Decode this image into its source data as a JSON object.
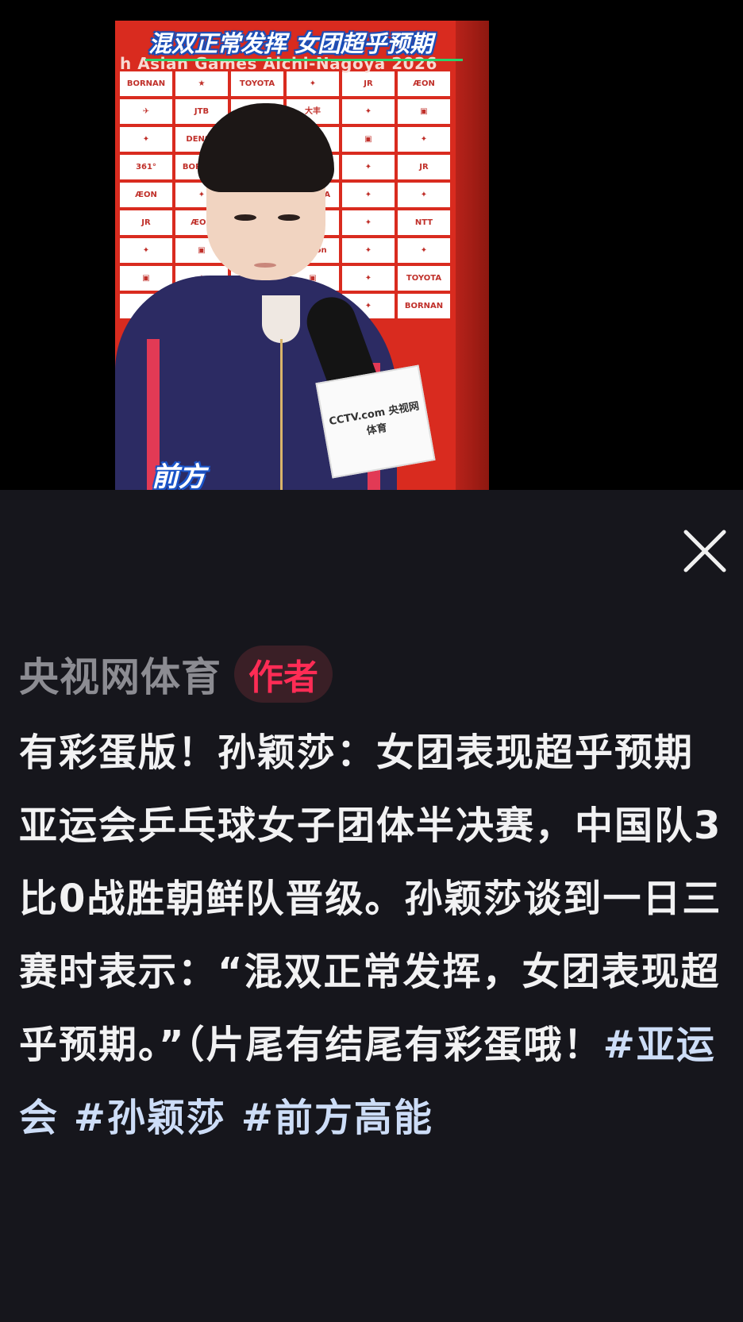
{
  "video": {
    "caption": "混双正常发挥 女团超乎预期",
    "event_text": "h Asian Games Aichi-Nagoya 2026",
    "source_logo": "前方",
    "mic_flag": "CCTV.com 央视网 体育",
    "backdrop_sponsors": [
      "BORNAN",
      "TOYOTA",
      "JR",
      "ÆON",
      "JTB",
      "361°",
      "NTT",
      "Canon",
      "DENSO",
      "大丰"
    ]
  },
  "panel": {
    "close_icon": "close-icon",
    "author": {
      "name": "央视网体育",
      "badge": "作者"
    },
    "description": {
      "title": "有彩蛋版！孙颖莎：女团表现超乎预期",
      "body": "亚运会乒乓球女子团体半决赛，中国队3比0战胜朝鲜队晋级。孙颖莎谈到一日三赛时表示：“混双正常发挥，女团表现超乎预期。”（片尾有结尾有彩蛋哦！",
      "hashtags": [
        "#亚运会",
        "#孙颖莎",
        "#前方高能"
      ]
    }
  },
  "colors": {
    "panel_bg": "#16161c",
    "text_primary": "#f2f2f3",
    "author_name": "#8c8c92",
    "badge_text": "#fe2c55",
    "hashtag": "#cdddf7"
  }
}
